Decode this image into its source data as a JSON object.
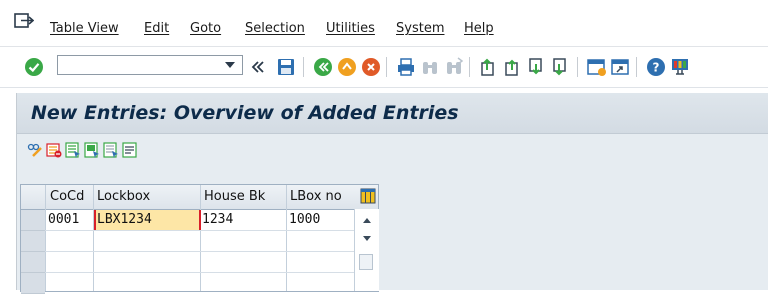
{
  "menubar": {
    "items": [
      {
        "label": "Table View"
      },
      {
        "label": "Edit"
      },
      {
        "label": "Goto"
      },
      {
        "label": "Selection"
      },
      {
        "label": "Utilities"
      },
      {
        "label": "System"
      },
      {
        "label": "Help"
      }
    ],
    "exit_icon": "exit-menu-icon"
  },
  "toolbar": {
    "command_field_value": "",
    "icons": [
      "enter-checkmark-icon",
      "dropdown-arrow-icon",
      "back-chevron-icon",
      "save-icon",
      "back-green-icon",
      "exit-orange-icon",
      "cancel-red-icon",
      "print-icon",
      "find-icon",
      "find-next-icon",
      "first-page-icon",
      "previous-page-icon",
      "next-page-icon",
      "last-page-icon",
      "new-session-icon",
      "shortcut-icon",
      "help-icon",
      "customize-layout-icon"
    ]
  },
  "page": {
    "title": "New Entries: Overview of Added Entries"
  },
  "app_toolbar": {
    "icons": [
      "change-display-icon",
      "delete-icon",
      "select-all-icon",
      "select-block-icon",
      "deselect-all-icon",
      "details-icon"
    ]
  },
  "table": {
    "columns": [
      {
        "label": "CoCd"
      },
      {
        "label": "Lockbox"
      },
      {
        "label": "House Bk"
      },
      {
        "label": "LBox no"
      }
    ],
    "rows": [
      {
        "cocd": "0001",
        "lockbox": "LBX1234",
        "house_bk": "1234",
        "lbox_no": "1000"
      },
      {
        "cocd": "",
        "lockbox": "",
        "house_bk": "",
        "lbox_no": ""
      },
      {
        "cocd": "",
        "lockbox": "",
        "house_bk": "",
        "lbox_no": ""
      },
      {
        "cocd": "",
        "lockbox": "",
        "house_bk": "",
        "lbox_no": ""
      }
    ]
  },
  "colors": {
    "title_text": "#0d2b4a",
    "edit_cell_bg": "#fde6a6",
    "edit_cell_border": "#d8202a",
    "enter_green": "#3aa847"
  }
}
